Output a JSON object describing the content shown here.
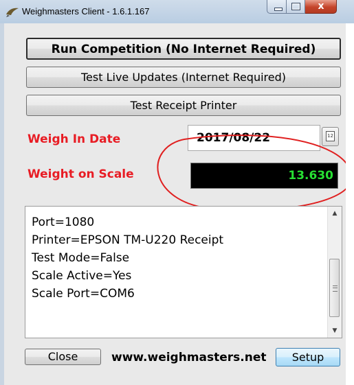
{
  "window": {
    "title": "Weighmasters Client - 1.6.1.167",
    "controls": {
      "minimize_icon": "minimize-icon",
      "maximize_icon": "maximize-icon",
      "close_glyph": "x"
    }
  },
  "buttons": {
    "run_competition": "Run Competition (No Internet Required)",
    "test_live_updates": "Test Live Updates (Internet Required)",
    "test_receipt_printer": "Test Receipt Printer",
    "close": "Close",
    "setup": "Setup"
  },
  "fields": {
    "weigh_in_date_label": "Weigh In Date",
    "weigh_in_date_value": "2017/08/22",
    "weight_on_scale_label": "Weight on Scale",
    "weight_on_scale_value": "13.630"
  },
  "log": {
    "lines": [
      "Port=1080",
      "Printer=EPSON TM-U220 Receipt",
      "Test Mode=False",
      "Scale Active=Yes",
      "Scale Port=COM6"
    ]
  },
  "footer": {
    "website": "www.weighmasters.net"
  },
  "colors": {
    "label_red": "#e81c24",
    "scale_digits": "#27e033",
    "scale_background": "#000000",
    "annotation_ellipse": "#e02020"
  }
}
